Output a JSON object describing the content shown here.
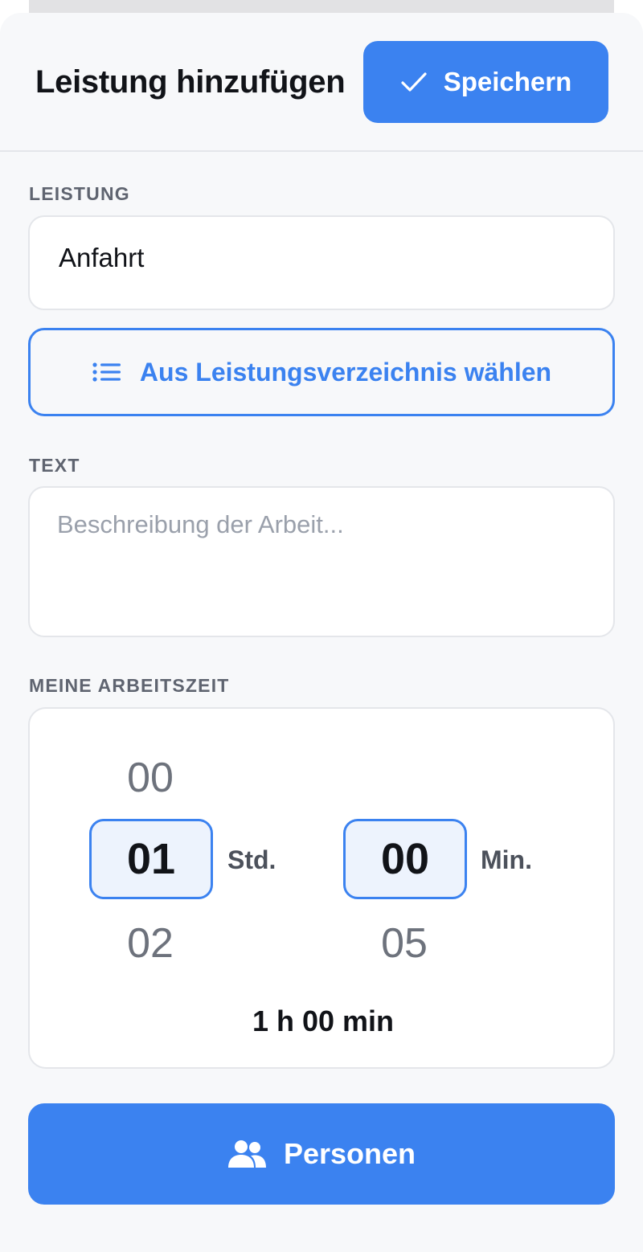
{
  "header": {
    "title": "Leistung hinzufügen",
    "save_label": "Speichern"
  },
  "service": {
    "label": "LEISTUNG",
    "value": "Anfahrt",
    "catalog_button": "Aus Leistungsverzeichnis wählen"
  },
  "text": {
    "label": "TEXT",
    "placeholder": "Beschreibung der Arbeit...",
    "value": ""
  },
  "worktime": {
    "label": "MEINE ARBEITSZEIT",
    "hours": {
      "prev": "00",
      "selected": "01",
      "next": "02",
      "unit": "Std."
    },
    "minutes": {
      "prev": "",
      "selected": "00",
      "next": "05",
      "unit": "Min."
    },
    "total": "1 h 00 min"
  },
  "persons_button": "Personen",
  "colors": {
    "accent": "#3b82f0",
    "background": "#f7f8fa",
    "selected_fill": "#edf3fd"
  },
  "icons": {
    "save": "checkmark-icon",
    "catalog": "list-icon",
    "persons": "people-icon"
  }
}
